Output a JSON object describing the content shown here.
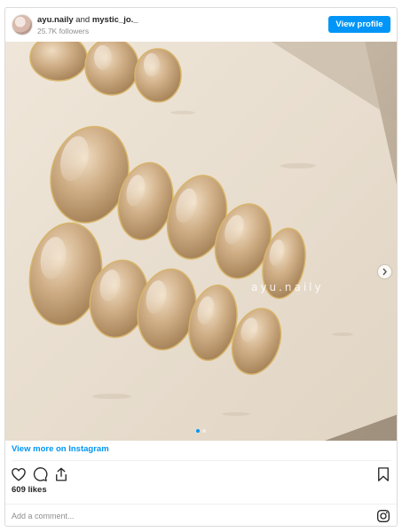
{
  "header": {
    "username": "ayu.naily",
    "and_text": " and ",
    "collaborator": "mystic_jo._",
    "followers": "25.7K followers",
    "view_profile_label": "View profile"
  },
  "photo": {
    "watermark": "ayu.naily",
    "carousel_count": 2,
    "carousel_active": 1
  },
  "links": {
    "view_more_label": "View more on Instagram"
  },
  "engagement": {
    "likes": "609 likes"
  },
  "comment": {
    "placeholder": "Add a comment..."
  },
  "colors": {
    "accent": "#0095f6",
    "text": "#262626",
    "muted": "#8e8e8e"
  },
  "icons": [
    "heart-icon",
    "comment-icon",
    "share-icon",
    "bookmark-icon",
    "instagram-icon",
    "chevron-right-icon"
  ]
}
